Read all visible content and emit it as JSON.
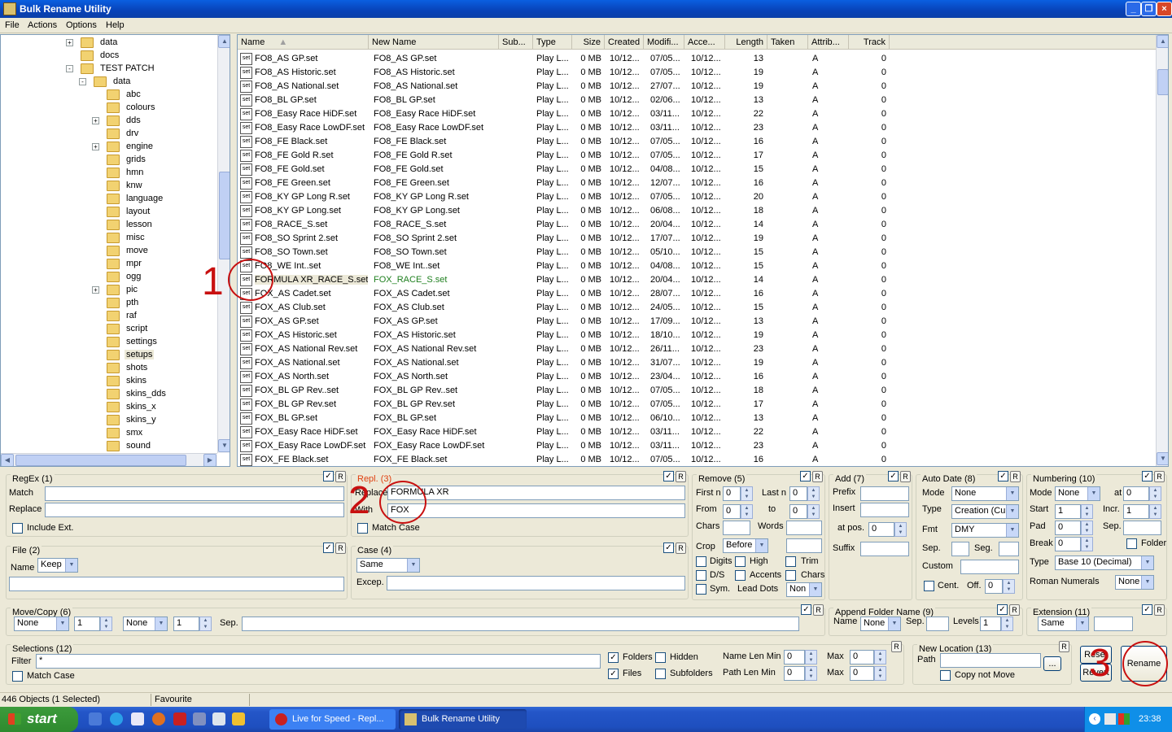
{
  "window": {
    "title": "Bulk Rename Utility"
  },
  "menu": [
    "File",
    "Actions",
    "Options",
    "Help"
  ],
  "tree": [
    {
      "label": "data",
      "level": 0,
      "pm": "+"
    },
    {
      "label": "docs",
      "level": 0,
      "pm": ""
    },
    {
      "label": "TEST PATCH",
      "level": 0,
      "pm": "-"
    },
    {
      "label": "data",
      "level": 1,
      "pm": "-"
    },
    {
      "label": "abc",
      "level": 2,
      "pm": ""
    },
    {
      "label": "colours",
      "level": 2,
      "pm": ""
    },
    {
      "label": "dds",
      "level": 2,
      "pm": "+"
    },
    {
      "label": "drv",
      "level": 2,
      "pm": ""
    },
    {
      "label": "engine",
      "level": 2,
      "pm": "+"
    },
    {
      "label": "grids",
      "level": 2,
      "pm": ""
    },
    {
      "label": "hmn",
      "level": 2,
      "pm": ""
    },
    {
      "label": "knw",
      "level": 2,
      "pm": ""
    },
    {
      "label": "language",
      "level": 2,
      "pm": ""
    },
    {
      "label": "layout",
      "level": 2,
      "pm": ""
    },
    {
      "label": "lesson",
      "level": 2,
      "pm": ""
    },
    {
      "label": "misc",
      "level": 2,
      "pm": ""
    },
    {
      "label": "move",
      "level": 2,
      "pm": ""
    },
    {
      "label": "mpr",
      "level": 2,
      "pm": ""
    },
    {
      "label": "ogg",
      "level": 2,
      "pm": ""
    },
    {
      "label": "pic",
      "level": 2,
      "pm": "+"
    },
    {
      "label": "pth",
      "level": 2,
      "pm": ""
    },
    {
      "label": "raf",
      "level": 2,
      "pm": ""
    },
    {
      "label": "script",
      "level": 2,
      "pm": ""
    },
    {
      "label": "settings",
      "level": 2,
      "pm": ""
    },
    {
      "label": "setups",
      "level": 2,
      "pm": "",
      "selected": true
    },
    {
      "label": "shots",
      "level": 2,
      "pm": ""
    },
    {
      "label": "skins",
      "level": 2,
      "pm": ""
    },
    {
      "label": "skins_dds",
      "level": 2,
      "pm": ""
    },
    {
      "label": "skins_x",
      "level": 2,
      "pm": ""
    },
    {
      "label": "skins_y",
      "level": 2,
      "pm": ""
    },
    {
      "label": "smx",
      "level": 2,
      "pm": ""
    },
    {
      "label": "sound",
      "level": 2,
      "pm": ""
    }
  ],
  "columns": [
    "Name",
    "New Name",
    "Sub...",
    "Type",
    "Size",
    "Created",
    "Modifi...",
    "Acce...",
    "Length",
    "Taken",
    "Attrib...",
    "Track"
  ],
  "file_icon_text": "set",
  "files": [
    {
      "name": "FO8_AS GP.set",
      "new": "FO8_AS GP.set",
      "type": "Play L...",
      "size": "0 MB",
      "created": "10/12...",
      "mod": "07/05...",
      "acc": "10/12...",
      "len": "13",
      "attr": "A",
      "track": "0"
    },
    {
      "name": "FO8_AS Historic.set",
      "new": "FO8_AS Historic.set",
      "type": "Play L...",
      "size": "0 MB",
      "created": "10/12...",
      "mod": "07/05...",
      "acc": "10/12...",
      "len": "19",
      "attr": "A",
      "track": "0"
    },
    {
      "name": "FO8_AS National.set",
      "new": "FO8_AS National.set",
      "type": "Play L...",
      "size": "0 MB",
      "created": "10/12...",
      "mod": "27/07...",
      "acc": "10/12...",
      "len": "19",
      "attr": "A",
      "track": "0"
    },
    {
      "name": "FO8_BL GP.set",
      "new": "FO8_BL GP.set",
      "type": "Play L...",
      "size": "0 MB",
      "created": "10/12...",
      "mod": "02/06...",
      "acc": "10/12...",
      "len": "13",
      "attr": "A",
      "track": "0"
    },
    {
      "name": "FO8_Easy Race HiDF.set",
      "new": "FO8_Easy Race HiDF.set",
      "type": "Play L...",
      "size": "0 MB",
      "created": "10/12...",
      "mod": "03/11...",
      "acc": "10/12...",
      "len": "22",
      "attr": "A",
      "track": "0"
    },
    {
      "name": "FO8_Easy Race LowDF.set",
      "new": "FO8_Easy Race LowDF.set",
      "type": "Play L...",
      "size": "0 MB",
      "created": "10/12...",
      "mod": "03/11...",
      "acc": "10/12...",
      "len": "23",
      "attr": "A",
      "track": "0"
    },
    {
      "name": "FO8_FE Black.set",
      "new": "FO8_FE Black.set",
      "type": "Play L...",
      "size": "0 MB",
      "created": "10/12...",
      "mod": "07/05...",
      "acc": "10/12...",
      "len": "16",
      "attr": "A",
      "track": "0"
    },
    {
      "name": "FO8_FE Gold R.set",
      "new": "FO8_FE Gold R.set",
      "type": "Play L...",
      "size": "0 MB",
      "created": "10/12...",
      "mod": "07/05...",
      "acc": "10/12...",
      "len": "17",
      "attr": "A",
      "track": "0"
    },
    {
      "name": "FO8_FE Gold.set",
      "new": "FO8_FE Gold.set",
      "type": "Play L...",
      "size": "0 MB",
      "created": "10/12...",
      "mod": "04/08...",
      "acc": "10/12...",
      "len": "15",
      "attr": "A",
      "track": "0"
    },
    {
      "name": "FO8_FE Green.set",
      "new": "FO8_FE Green.set",
      "type": "Play L...",
      "size": "0 MB",
      "created": "10/12...",
      "mod": "12/07...",
      "acc": "10/12...",
      "len": "16",
      "attr": "A",
      "track": "0"
    },
    {
      "name": "FO8_KY GP Long R.set",
      "new": "FO8_KY GP Long R.set",
      "type": "Play L...",
      "size": "0 MB",
      "created": "10/12...",
      "mod": "07/05...",
      "acc": "10/12...",
      "len": "20",
      "attr": "A",
      "track": "0"
    },
    {
      "name": "FO8_KY GP Long.set",
      "new": "FO8_KY GP Long.set",
      "type": "Play L...",
      "size": "0 MB",
      "created": "10/12...",
      "mod": "06/08...",
      "acc": "10/12...",
      "len": "18",
      "attr": "A",
      "track": "0"
    },
    {
      "name": "FO8_RACE_S.set",
      "new": "FO8_RACE_S.set",
      "type": "Play L...",
      "size": "0 MB",
      "created": "10/12...",
      "mod": "20/04...",
      "acc": "10/12...",
      "len": "14",
      "attr": "A",
      "track": "0"
    },
    {
      "name": "FO8_SO Sprint 2.set",
      "new": "FO8_SO Sprint 2.set",
      "type": "Play L...",
      "size": "0 MB",
      "created": "10/12...",
      "mod": "17/07...",
      "acc": "10/12...",
      "len": "19",
      "attr": "A",
      "track": "0"
    },
    {
      "name": "FO8_SO Town.set",
      "new": "FO8_SO Town.set",
      "type": "Play L...",
      "size": "0 MB",
      "created": "10/12...",
      "mod": "05/10...",
      "acc": "10/12...",
      "len": "15",
      "attr": "A",
      "track": "0"
    },
    {
      "name": "FO8_WE Int..set",
      "new": "FO8_WE Int..set",
      "type": "Play L...",
      "size": "0 MB",
      "created": "10/12...",
      "mod": "04/08...",
      "acc": "10/12...",
      "len": "15",
      "attr": "A",
      "track": "0"
    },
    {
      "name": "FORMULA XR_RACE_S.set",
      "new": "FOX_RACE_S.set",
      "type": "Play L...",
      "size": "0 MB",
      "created": "10/12...",
      "mod": "20/04...",
      "acc": "10/12...",
      "len": "14",
      "attr": "A",
      "track": "0",
      "selected": true
    },
    {
      "name": "FOX_AS Cadet.set",
      "new": "FOX_AS Cadet.set",
      "type": "Play L...",
      "size": "0 MB",
      "created": "10/12...",
      "mod": "28/07...",
      "acc": "10/12...",
      "len": "16",
      "attr": "A",
      "track": "0"
    },
    {
      "name": "FOX_AS Club.set",
      "new": "FOX_AS Club.set",
      "type": "Play L...",
      "size": "0 MB",
      "created": "10/12...",
      "mod": "24/05...",
      "acc": "10/12...",
      "len": "15",
      "attr": "A",
      "track": "0"
    },
    {
      "name": "FOX_AS GP.set",
      "new": "FOX_AS GP.set",
      "type": "Play L...",
      "size": "0 MB",
      "created": "10/12...",
      "mod": "17/09...",
      "acc": "10/12...",
      "len": "13",
      "attr": "A",
      "track": "0"
    },
    {
      "name": "FOX_AS Historic.set",
      "new": "FOX_AS Historic.set",
      "type": "Play L...",
      "size": "0 MB",
      "created": "10/12...",
      "mod": "18/10...",
      "acc": "10/12...",
      "len": "19",
      "attr": "A",
      "track": "0"
    },
    {
      "name": "FOX_AS National Rev.set",
      "new": "FOX_AS National Rev.set",
      "type": "Play L...",
      "size": "0 MB",
      "created": "10/12...",
      "mod": "26/11...",
      "acc": "10/12...",
      "len": "23",
      "attr": "A",
      "track": "0"
    },
    {
      "name": "FOX_AS National.set",
      "new": "FOX_AS National.set",
      "type": "Play L...",
      "size": "0 MB",
      "created": "10/12...",
      "mod": "31/07...",
      "acc": "10/12...",
      "len": "19",
      "attr": "A",
      "track": "0"
    },
    {
      "name": "FOX_AS North.set",
      "new": "FOX_AS North.set",
      "type": "Play L...",
      "size": "0 MB",
      "created": "10/12...",
      "mod": "23/04...",
      "acc": "10/12...",
      "len": "16",
      "attr": "A",
      "track": "0"
    },
    {
      "name": "FOX_BL GP Rev..set",
      "new": "FOX_BL GP Rev..set",
      "type": "Play L...",
      "size": "0 MB",
      "created": "10/12...",
      "mod": "07/05...",
      "acc": "10/12...",
      "len": "18",
      "attr": "A",
      "track": "0"
    },
    {
      "name": "FOX_BL GP Rev.set",
      "new": "FOX_BL GP Rev.set",
      "type": "Play L...",
      "size": "0 MB",
      "created": "10/12...",
      "mod": "07/05...",
      "acc": "10/12...",
      "len": "17",
      "attr": "A",
      "track": "0"
    },
    {
      "name": "FOX_BL GP.set",
      "new": "FOX_BL GP.set",
      "type": "Play L...",
      "size": "0 MB",
      "created": "10/12...",
      "mod": "06/10...",
      "acc": "10/12...",
      "len": "13",
      "attr": "A",
      "track": "0"
    },
    {
      "name": "FOX_Easy Race HiDF.set",
      "new": "FOX_Easy Race HiDF.set",
      "type": "Play L...",
      "size": "0 MB",
      "created": "10/12...",
      "mod": "03/11...",
      "acc": "10/12...",
      "len": "22",
      "attr": "A",
      "track": "0"
    },
    {
      "name": "FOX_Easy Race LowDF.set",
      "new": "FOX_Easy Race LowDF.set",
      "type": "Play L...",
      "size": "0 MB",
      "created": "10/12...",
      "mod": "03/11...",
      "acc": "10/12...",
      "len": "23",
      "attr": "A",
      "track": "0"
    },
    {
      "name": "FOX_FE Black.set",
      "new": "FOX_FE Black.set",
      "type": "Play L...",
      "size": "0 MB",
      "created": "10/12...",
      "mod": "07/05...",
      "acc": "10/12...",
      "len": "16",
      "attr": "A",
      "track": "0"
    }
  ],
  "annotations": {
    "n1": "1",
    "n2": "2",
    "n3": "3"
  },
  "regex": {
    "title": "RegEx (1)",
    "match_label": "Match",
    "replace_label": "Replace",
    "include_ext": "Include Ext.",
    "r": "R"
  },
  "repl": {
    "title": "Repl. (3)",
    "replace_label": "Replace",
    "with_label": "With",
    "replace_value": "FORMULA XR",
    "with_value": "FOX",
    "match_case": "Match Case"
  },
  "remove": {
    "title": "Remove (5)",
    "first_n": "First n",
    "last_n": "Last n",
    "first_n_val": "0",
    "last_n_val": "0",
    "from": "From",
    "to": "to",
    "from_val": "0",
    "to_val": "0",
    "chars": "Chars",
    "words": "Words",
    "crop": "Crop",
    "crop_val": "Before",
    "digits": "Digits",
    "high": "High",
    "trim": "Trim",
    "ds": "D/S",
    "accents": "Accents",
    "chars2": "Chars",
    "sym": "Sym.",
    "lead_dots": "Lead Dots",
    "lead_val": "Non"
  },
  "add": {
    "title": "Add (7)",
    "prefix": "Prefix",
    "insert": "Insert",
    "at_pos": "at pos.",
    "at_pos_val": "0",
    "suffix": "Suffix"
  },
  "autodate": {
    "title": "Auto Date (8)",
    "mode": "Mode",
    "mode_val": "None",
    "type": "Type",
    "type_val": "Creation (Cur",
    "fmt": "Fmt",
    "fmt_val": "DMY",
    "sep": "Sep.",
    "seg": "Seg.",
    "custom": "Custom",
    "cent": "Cent.",
    "off": "Off.",
    "off_val": "0"
  },
  "numbering": {
    "title": "Numbering (10)",
    "mode": "Mode",
    "mode_val": "None",
    "at": "at",
    "at_val": "0",
    "start": "Start",
    "start_val": "1",
    "incr": "Incr.",
    "incr_val": "1",
    "pad": "Pad",
    "pad_val": "0",
    "sep": "Sep.",
    "break": "Break",
    "break_val": "0",
    "folder": "Folder",
    "type": "Type",
    "type_val": "Base 10 (Decimal)",
    "roman": "Roman Numerals",
    "roman_val": "None"
  },
  "file": {
    "title": "File (2)",
    "name": "Name",
    "name_val": "Keep"
  },
  "case": {
    "title": "Case (4)",
    "case_val": "Same",
    "excep": "Excep."
  },
  "movecopy": {
    "title": "Move/Copy (6)",
    "v1": "None",
    "v2": "1",
    "v3": "None",
    "v4": "1",
    "sep": "Sep."
  },
  "appendfolder": {
    "title": "Append Folder Name (9)",
    "name": "Name",
    "name_val": "None",
    "sep": "Sep.",
    "levels": "Levels",
    "levels_val": "1"
  },
  "extension": {
    "title": "Extension (11)",
    "val": "Same"
  },
  "selections": {
    "title": "Selections (12)",
    "filter": "Filter",
    "filter_val": "*",
    "match_case": "Match Case",
    "folders": "Folders",
    "hidden": "Hidden",
    "files": "Files",
    "subfolders": "Subfolders",
    "name_len_min": "Name Len Min",
    "path_len_min": "Path Len Min",
    "max": "Max",
    "v0": "0"
  },
  "newlocation": {
    "title": "New Location (13)",
    "path": "Path",
    "browse": "...",
    "copy_not_move": "Copy not Move"
  },
  "buttons": {
    "reset": "Reset",
    "revert": "Revert",
    "rename": "Rename"
  },
  "status": {
    "objects": "446 Objects (1 Selected)",
    "favourite": "Favourite"
  },
  "taskbar": {
    "start": "start",
    "task1": "Live for Speed - Repl...",
    "task2": "Bulk Rename Utility",
    "clock": "23:38"
  }
}
